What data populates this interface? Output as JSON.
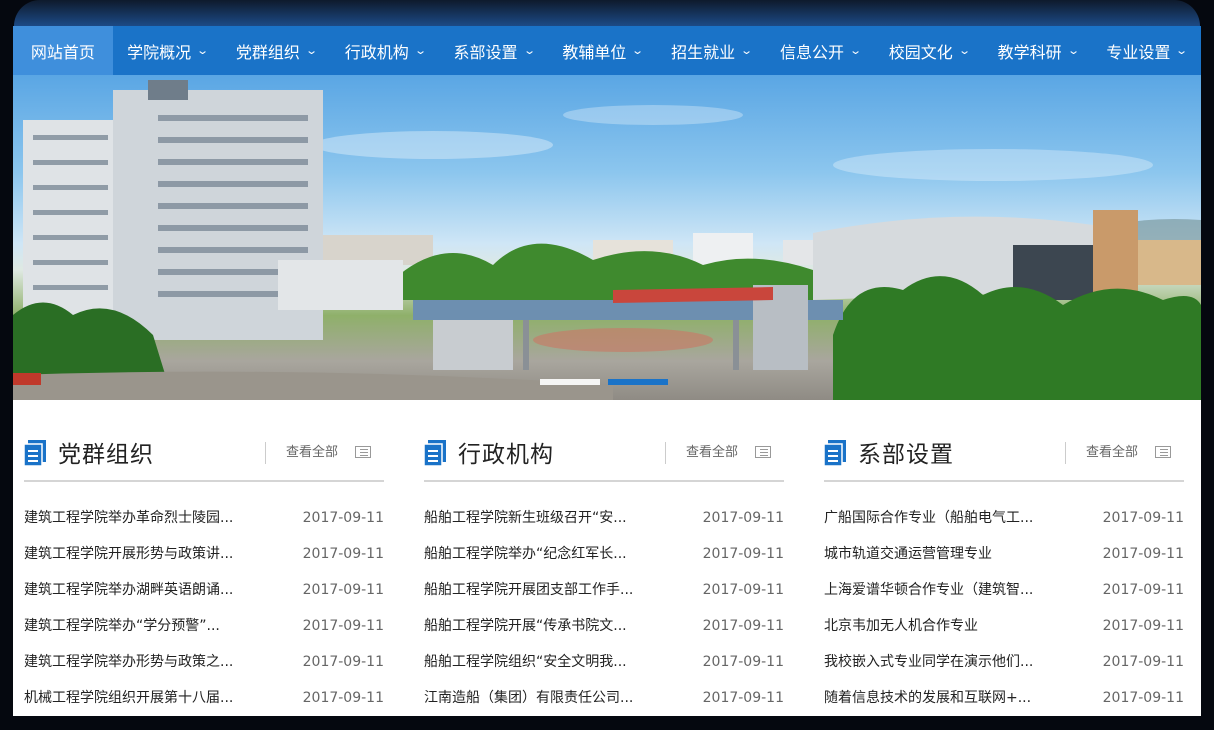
{
  "nav": {
    "items": [
      {
        "label": "网站首页",
        "active": true,
        "dropdown": false
      },
      {
        "label": "学院概况",
        "active": false,
        "dropdown": true
      },
      {
        "label": "党群组织",
        "active": false,
        "dropdown": true
      },
      {
        "label": "行政机构",
        "active": false,
        "dropdown": true
      },
      {
        "label": "系部设置",
        "active": false,
        "dropdown": true
      },
      {
        "label": "教辅单位",
        "active": false,
        "dropdown": true
      },
      {
        "label": "招生就业",
        "active": false,
        "dropdown": true
      },
      {
        "label": "信息公开",
        "active": false,
        "dropdown": true
      },
      {
        "label": "校园文化",
        "active": false,
        "dropdown": true
      },
      {
        "label": "教学科研",
        "active": false,
        "dropdown": true
      },
      {
        "label": "专业设置",
        "active": false,
        "dropdown": true
      }
    ],
    "chevron_icon": "chevron-down-icon",
    "colors": {
      "bar": "#1a73c8",
      "active": "#3f8fdc",
      "text": "#ffffff"
    }
  },
  "banner": {
    "slides_total": 2,
    "active_slide": 2
  },
  "columns": [
    {
      "title": "党群组织",
      "more_label": "查看全部",
      "items": [
        {
          "title": "建筑工程学院举办革命烈士陵园...",
          "date": "2017-09-11"
        },
        {
          "title": "建筑工程学院开展形势与政策讲...",
          "date": "2017-09-11"
        },
        {
          "title": "建筑工程学院举办湖畔英语朗诵...",
          "date": "2017-09-11"
        },
        {
          "title": "建筑工程学院举办“学分预警”...",
          "date": "2017-09-11"
        },
        {
          "title": "建筑工程学院举办形势与政策之...",
          "date": "2017-09-11"
        },
        {
          "title": "机械工程学院组织开展第十八届...",
          "date": "2017-09-11"
        }
      ]
    },
    {
      "title": "行政机构",
      "more_label": "查看全部",
      "items": [
        {
          "title": "船舶工程学院新生班级召开“安...",
          "date": "2017-09-11"
        },
        {
          "title": "船舶工程学院举办“纪念红军长...",
          "date": "2017-09-11"
        },
        {
          "title": "船舶工程学院开展团支部工作手...",
          "date": "2017-09-11"
        },
        {
          "title": "船舶工程学院开展“传承书院文...",
          "date": "2017-09-11"
        },
        {
          "title": "船舶工程学院组织“安全文明我...",
          "date": "2017-09-11"
        },
        {
          "title": "江南造船（集团）有限责任公司...",
          "date": "2017-09-11"
        }
      ]
    },
    {
      "title": "系部设置",
      "more_label": "查看全部",
      "items": [
        {
          "title": "广船国际合作专业（船舶电气工...",
          "date": "2017-09-11"
        },
        {
          "title": "城市轨道交通运营管理专业",
          "date": "2017-09-11"
        },
        {
          "title": "上海爱谱华顿合作专业（建筑智...",
          "date": "2017-09-11"
        },
        {
          "title": "北京韦加无人机合作专业",
          "date": "2017-09-11"
        },
        {
          "title": "我校嵌入式专业同学在演示他们...",
          "date": "2017-09-11"
        },
        {
          "title": "随着信息技术的发展和互联网+...",
          "date": "2017-09-11"
        }
      ]
    }
  ],
  "icons": {
    "column_icon": "document-icon",
    "more_icon": "list-icon"
  },
  "colors": {
    "accent": "#1a73c8",
    "title_text": "#222222",
    "date_text": "#666666",
    "divider": "#d5d5d5"
  }
}
